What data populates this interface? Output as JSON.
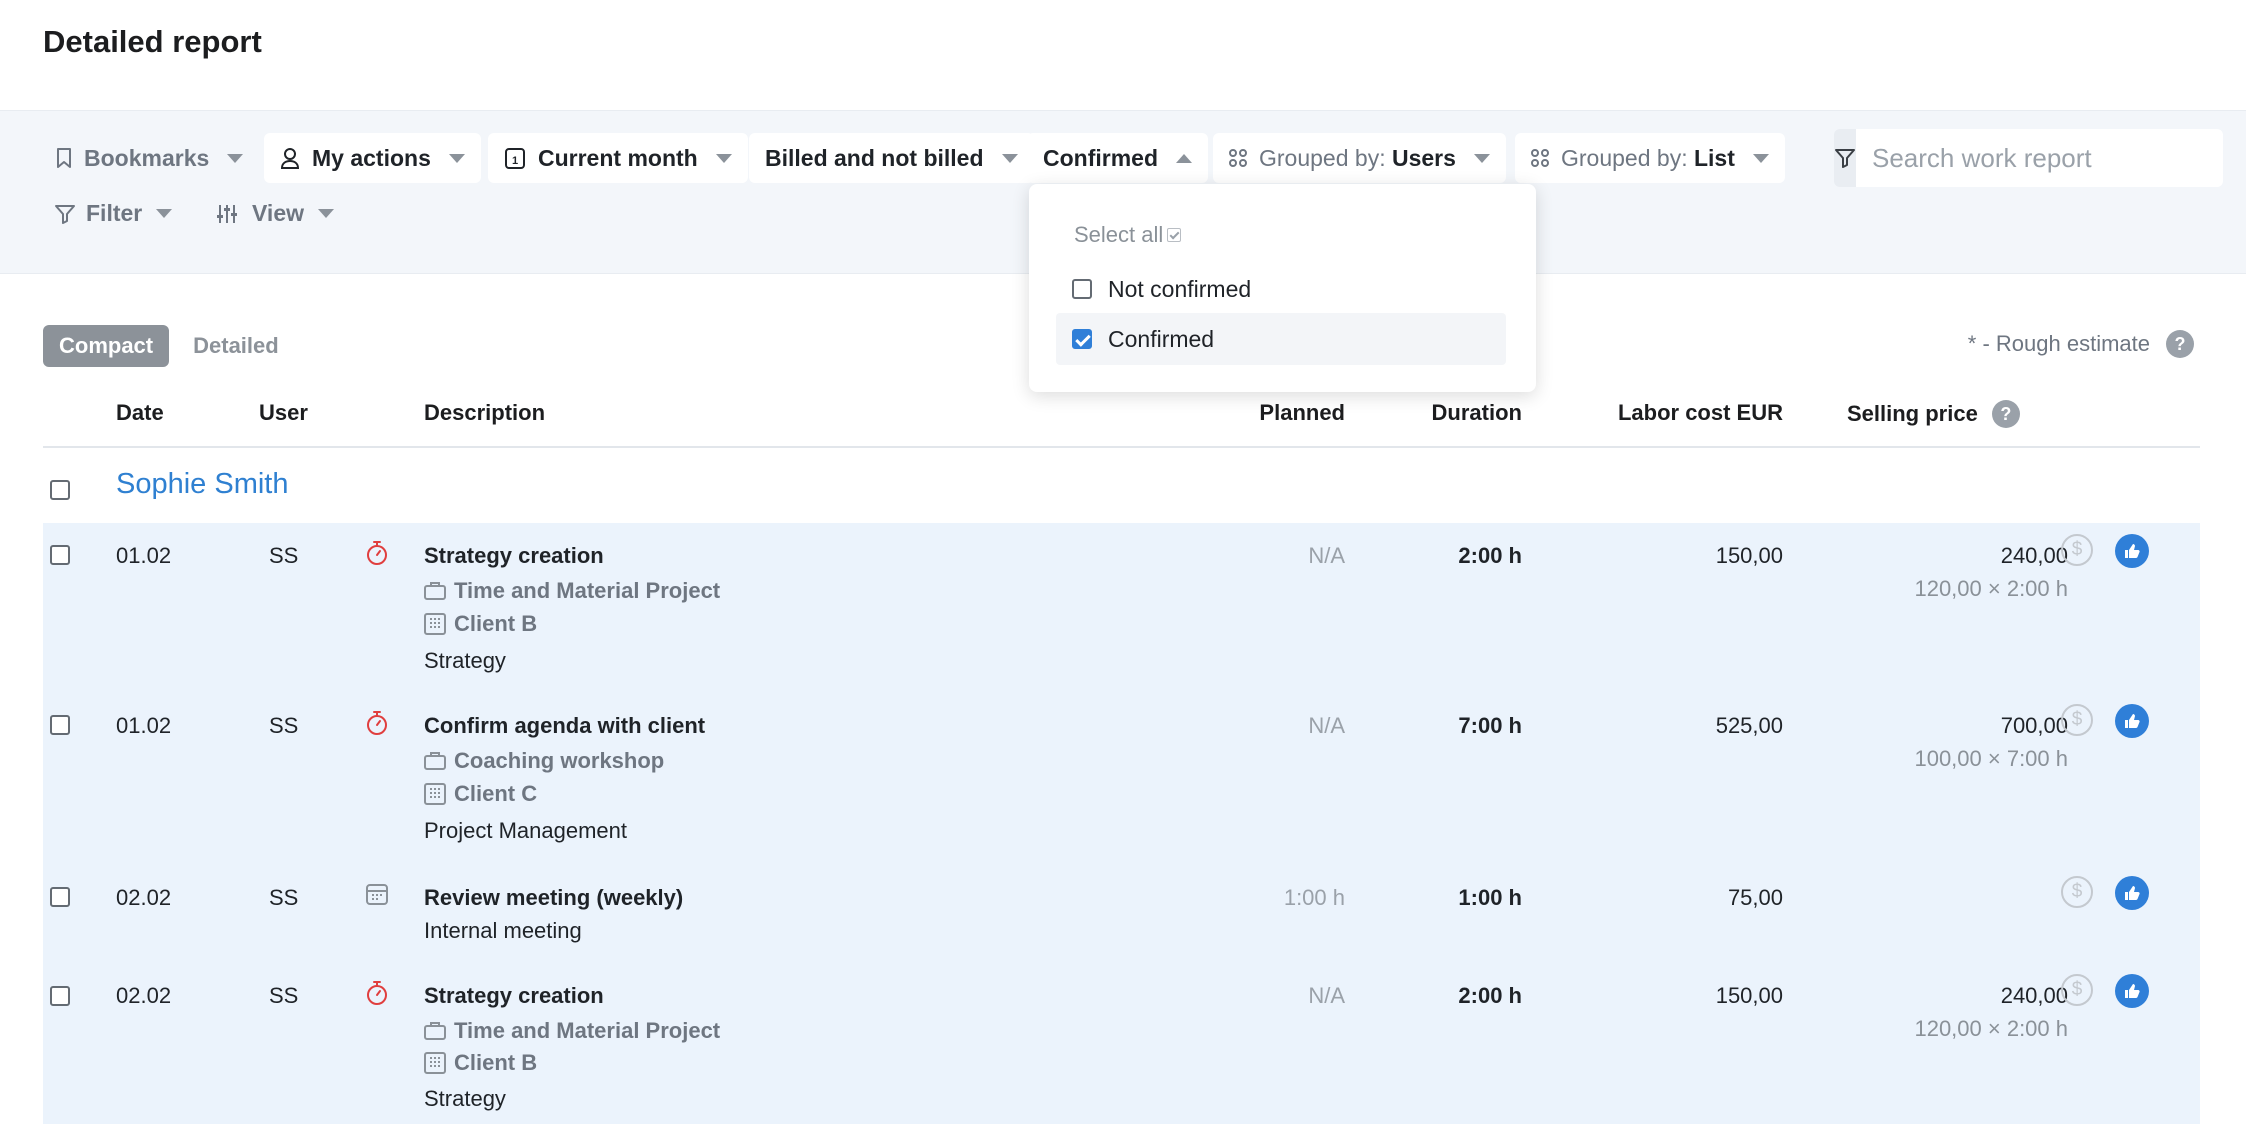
{
  "page": {
    "title": "Detailed report"
  },
  "toolbar": {
    "bookmarks": "Bookmarks",
    "my_actions": "My actions",
    "current_month": "Current month",
    "billed": "Billed and not billed",
    "confirmed": "Confirmed",
    "grouped_users_prefix": "Grouped by:",
    "grouped_users_value": "Users",
    "grouped_list_prefix": "Grouped by:",
    "grouped_list_value": "List",
    "search_placeholder": "Search work report",
    "filter": "Filter",
    "view": "View"
  },
  "dropdown": {
    "select_all": "Select all",
    "options": [
      {
        "label": "Not confirmed",
        "checked": false
      },
      {
        "label": "Confirmed",
        "checked": true
      }
    ]
  },
  "view_toggle": {
    "compact": "Compact",
    "detailed": "Detailed",
    "active": "Compact"
  },
  "rough_estimate": "* - Rough estimate",
  "help_icon": "?",
  "columns": {
    "date": "Date",
    "user": "User",
    "description": "Description",
    "planned": "Planned",
    "duration": "Duration",
    "labor_cost": "Labor cost EUR",
    "selling_price": "Selling price"
  },
  "group": {
    "name": "Sophie Smith"
  },
  "entries": [
    {
      "date": "01.02",
      "user": "SS",
      "icon": "stopwatch-icon",
      "title": "Strategy creation",
      "project": "Time and Material Project",
      "client": "Client B",
      "activity": "Strategy",
      "planned": "N/A",
      "duration": "2:00 h",
      "labor_cost": "150,00",
      "price": "240,00",
      "formula": "120,00 × 2:00 h"
    },
    {
      "date": "01.02",
      "user": "SS",
      "icon": "stopwatch-icon",
      "title": "Confirm agenda with client",
      "project": "Coaching workshop",
      "client": "Client C",
      "activity": "Project Management",
      "planned": "N/A",
      "duration": "7:00 h",
      "labor_cost": "525,00",
      "price": "700,00",
      "formula": "100,00 × 7:00 h"
    },
    {
      "date": "02.02",
      "user": "SS",
      "icon": "calendar-icon",
      "title": "Review meeting (weekly)",
      "activity": "Internal meeting",
      "planned": "1:00 h",
      "duration": "1:00 h",
      "labor_cost": "75,00"
    },
    {
      "date": "02.02",
      "user": "SS",
      "icon": "stopwatch-icon",
      "title": "Strategy creation",
      "project": "Time and Material Project",
      "client": "Client B",
      "activity": "Strategy",
      "planned": "N/A",
      "duration": "2:00 h",
      "labor_cost": "150,00",
      "price": "240,00",
      "formula": "120,00 × 2:00 h"
    }
  ],
  "colors": {
    "accent": "#2f7fd8",
    "link": "#2f80d1",
    "row_bg": "#ebf3fc",
    "timer_red": "#e03e3e"
  }
}
